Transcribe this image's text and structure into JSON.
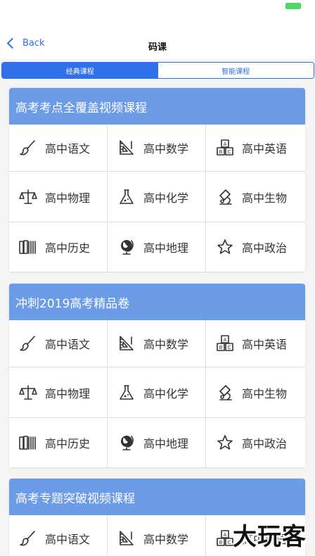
{
  "nav": {
    "back_label": "Back",
    "title": "码课"
  },
  "tabs": [
    {
      "label": "经典课程",
      "active": true
    },
    {
      "label": "智能课程",
      "active": false
    }
  ],
  "colors": {
    "accent": "#2f6fe8",
    "section_header": "#6c9be8",
    "battery": "#4cd964"
  },
  "sections": [
    {
      "title": "高考考点全覆盖视频课程",
      "subjects": [
        {
          "label": "高中语文",
          "icon": "brush-icon"
        },
        {
          "label": "高中数学",
          "icon": "ruler-icon"
        },
        {
          "label": "高中英语",
          "icon": "abc-blocks-icon"
        },
        {
          "label": "高中物理",
          "icon": "scale-icon"
        },
        {
          "label": "高中化学",
          "icon": "flask-icon"
        },
        {
          "label": "高中生物",
          "icon": "microscope-icon"
        },
        {
          "label": "高中历史",
          "icon": "books-icon"
        },
        {
          "label": "高中地理",
          "icon": "globe-icon"
        },
        {
          "label": "高中政治",
          "icon": "star-icon"
        }
      ]
    },
    {
      "title": "冲刺2019高考精品卷",
      "subjects": [
        {
          "label": "高中语文",
          "icon": "brush-icon"
        },
        {
          "label": "高中数学",
          "icon": "ruler-icon"
        },
        {
          "label": "高中英语",
          "icon": "abc-blocks-icon"
        },
        {
          "label": "高中物理",
          "icon": "scale-icon"
        },
        {
          "label": "高中化学",
          "icon": "flask-icon"
        },
        {
          "label": "高中生物",
          "icon": "microscope-icon"
        },
        {
          "label": "高中历史",
          "icon": "books-icon"
        },
        {
          "label": "高中地理",
          "icon": "globe-icon"
        },
        {
          "label": "高中政治",
          "icon": "star-icon"
        }
      ]
    },
    {
      "title": "高考专题突破视频课程",
      "subjects": [
        {
          "label": "高中语文",
          "icon": "brush-icon"
        },
        {
          "label": "高中数学",
          "icon": "ruler-icon"
        },
        {
          "label": "高中英语",
          "icon": "abc-blocks-icon"
        }
      ]
    }
  ],
  "watermark": "大玩客"
}
